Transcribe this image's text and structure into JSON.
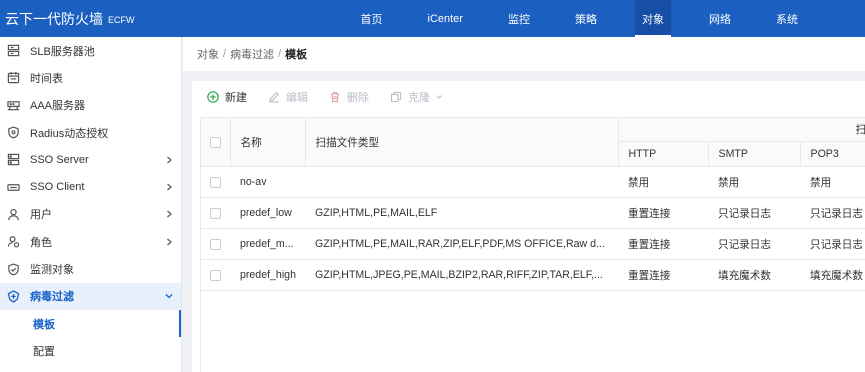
{
  "app": {
    "title": "云下一代防火墙",
    "edition": "ECFW"
  },
  "nav": {
    "items": [
      {
        "label": "首页"
      },
      {
        "label": "iCenter"
      },
      {
        "label": "监控"
      },
      {
        "label": "策略"
      },
      {
        "label": "对象",
        "active": true
      },
      {
        "label": "网络"
      },
      {
        "label": "系统"
      }
    ]
  },
  "sidebar": {
    "items": [
      {
        "label": "SLB服务器池",
        "icon": "server-cluster-icon"
      },
      {
        "label": "时间表",
        "icon": "calendar-icon"
      },
      {
        "label": "AAA服务器",
        "icon": "server-icon"
      },
      {
        "label": "Radius动态授权",
        "icon": "shield-icon"
      },
      {
        "label": "SSO Server",
        "icon": "server-rack-icon",
        "expandable": true
      },
      {
        "label": "SSO Client",
        "icon": "client-device-icon",
        "expandable": true
      },
      {
        "label": "用户",
        "icon": "user-icon",
        "expandable": true
      },
      {
        "label": "角色",
        "icon": "role-icon",
        "expandable": true
      },
      {
        "label": "监测对象",
        "icon": "shield-check-icon"
      },
      {
        "label": "病毒过滤",
        "icon": "virus-filter-icon",
        "expanded": true,
        "active": true,
        "children": [
          {
            "label": "模板",
            "active": true
          },
          {
            "label": "配置"
          }
        ]
      }
    ]
  },
  "breadcrumb": {
    "items": [
      "对象",
      "病毒过滤"
    ],
    "separator": "/",
    "current": "模板"
  },
  "toolbar": {
    "new": {
      "label": "新建",
      "enabled": true,
      "icon": "add-circle-icon"
    },
    "edit": {
      "label": "编辑",
      "enabled": false,
      "icon": "pencil-icon"
    },
    "delete": {
      "label": "删除",
      "enabled": false,
      "icon": "trash-icon"
    },
    "clone": {
      "label": "克隆",
      "enabled": false,
      "icon": "copy-icon",
      "dropdown": true
    }
  },
  "table": {
    "headers": {
      "name": "名称",
      "file_types": "扫描文件类型",
      "group": "扫",
      "http": "HTTP",
      "smtp": "SMTP",
      "pop3": "POP3"
    },
    "rows": [
      {
        "name": "no-av",
        "file_types": "",
        "http": "禁用",
        "smtp": "禁用",
        "pop3": "禁用"
      },
      {
        "name": "predef_low",
        "file_types": "GZIP,HTML,PE,MAIL,ELF",
        "http": "重置连接",
        "smtp": "只记录日志",
        "pop3": "只记录日志"
      },
      {
        "name": "predef_m...",
        "file_types": "GZIP,HTML,PE,MAIL,RAR,ZIP,ELF,PDF,MS OFFICE,Raw d...",
        "http": "重置连接",
        "smtp": "只记录日志",
        "pop3": "只记录日志"
      },
      {
        "name": "predef_high",
        "file_types": "GZIP,HTML,JPEG,PE,MAIL,BZIP2,RAR,RIFF,ZIP,TAR,ELF,...",
        "http": "重置连接",
        "smtp": "填充魔术数",
        "pop3": "填充魔术数"
      }
    ]
  },
  "colors": {
    "header_bg": "#1b5fc0",
    "header_active": "#164fa5",
    "accent": "#1a63c8",
    "sidebar_active_bg": "#e8f0fb",
    "add_green": "#2ea84a",
    "disabled": "#b9bec7",
    "page_bg": "#eef0f3"
  }
}
